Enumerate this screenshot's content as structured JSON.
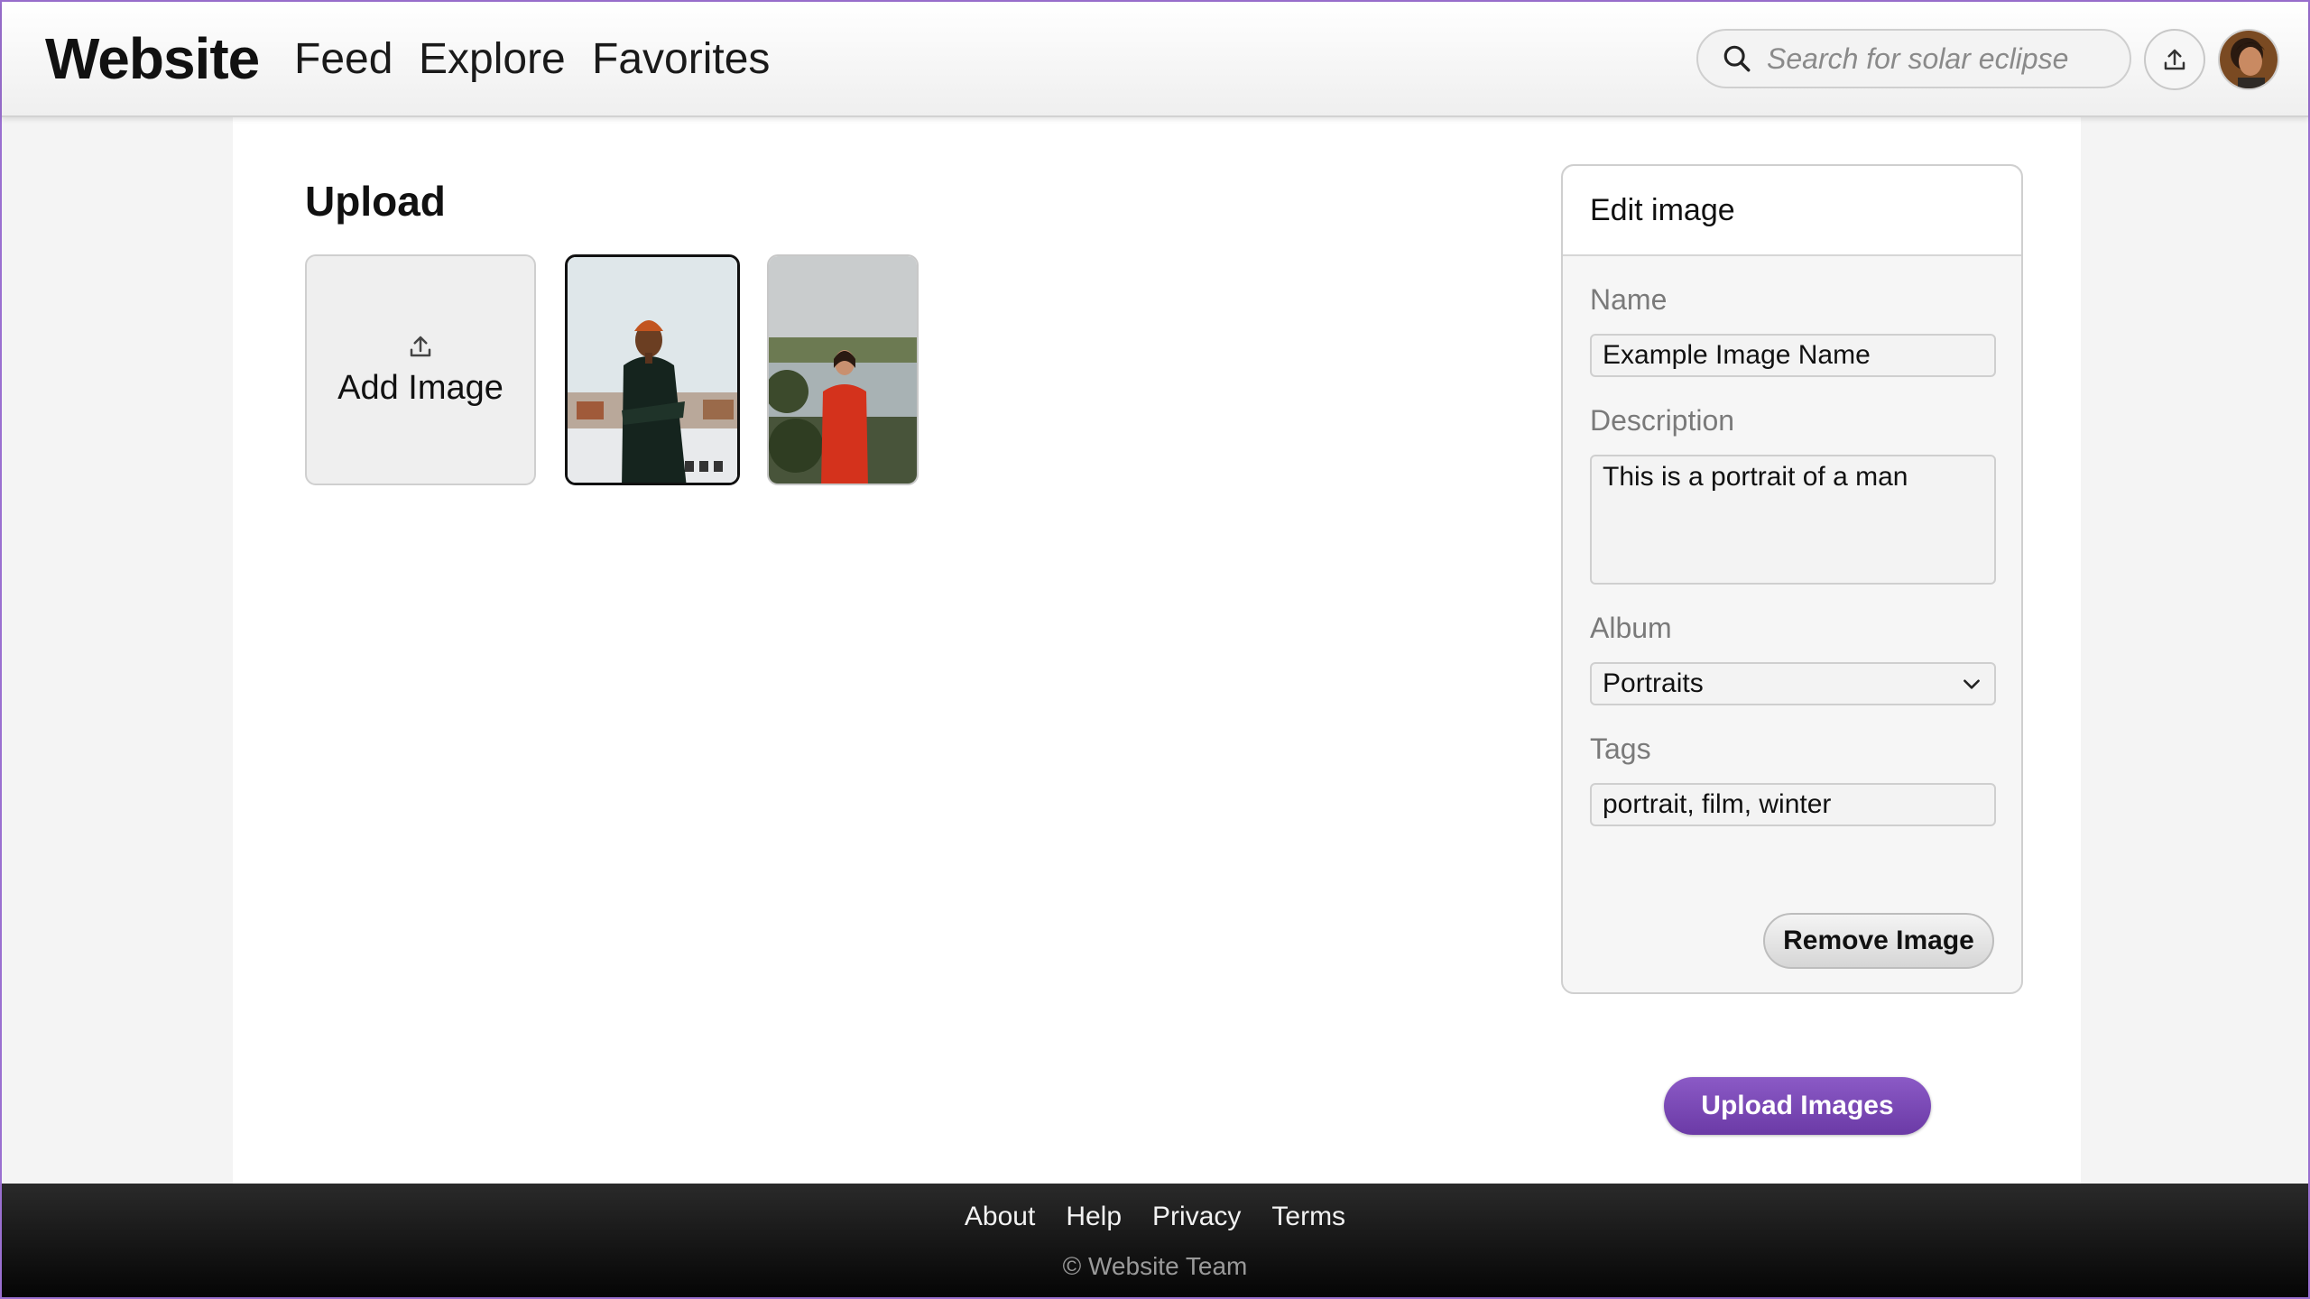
{
  "header": {
    "logo": "Website",
    "nav": [
      "Feed",
      "Explore",
      "Favorites"
    ],
    "search_placeholder": "Search for solar eclipse",
    "icons": {
      "search": "search-icon",
      "upload": "upload-icon",
      "avatar": "user-avatar"
    }
  },
  "main": {
    "title": "Upload",
    "add_image_label": "Add Image",
    "images": [
      {
        "selected": true,
        "subject": "man in orange beanie and black turtleneck"
      },
      {
        "selected": false,
        "subject": "woman in red dress by a lake"
      }
    ]
  },
  "edit_panel": {
    "title": "Edit image",
    "name_label": "Name",
    "name_value": "Example Image Name",
    "description_label": "Description",
    "description_value": "This is a portrait of a man",
    "album_label": "Album",
    "album_value": "Portraits",
    "tags_label": "Tags",
    "tags_value": "portrait, film, winter",
    "remove_label": "Remove Image"
  },
  "upload_button": "Upload Images",
  "footer": {
    "links": [
      "About",
      "Help",
      "Privacy",
      "Terms"
    ],
    "copyright": "© Website Team"
  },
  "colors": {
    "accent": "#7b4bb8",
    "frame": "#9a6fd0",
    "footer_bg": "#151515"
  }
}
